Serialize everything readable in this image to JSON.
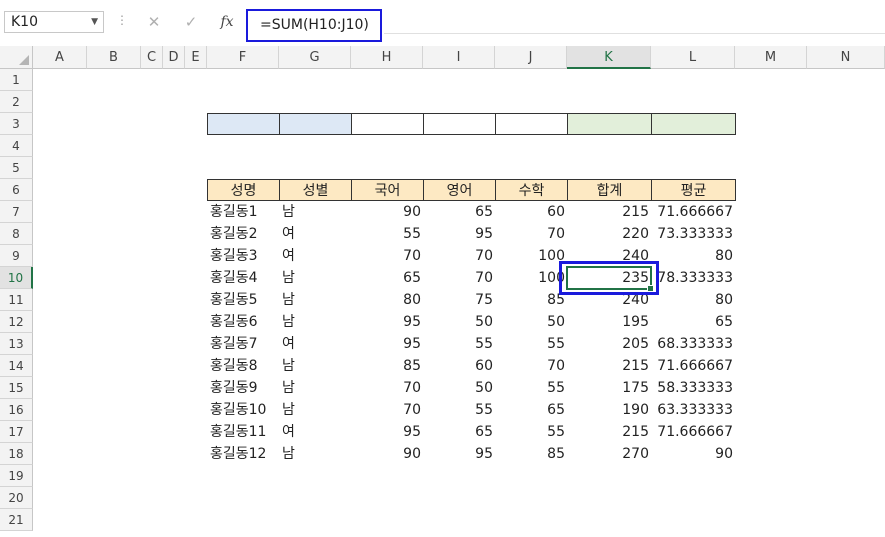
{
  "formula_bar": {
    "name_box": "K10",
    "cancel_icon": "✕",
    "enter_icon": "✓",
    "fx_label": "fx",
    "formula": "=SUM(H10:J10)"
  },
  "columns": [
    "A",
    "B",
    "C",
    "D",
    "E",
    "F",
    "G",
    "H",
    "I",
    "J",
    "K",
    "L",
    "M",
    "N"
  ],
  "rows": [
    "1",
    "2",
    "3",
    "4",
    "5",
    "6",
    "7",
    "8",
    "9",
    "10",
    "11",
    "12",
    "13",
    "14",
    "15",
    "16",
    "17",
    "18",
    "19",
    "20",
    "21"
  ],
  "selected_cell": "K10",
  "table": {
    "headers": [
      "성명",
      "성별",
      "국어",
      "영어",
      "수학",
      "합계",
      "평균"
    ],
    "rows": [
      [
        "홍길동1",
        "남",
        "90",
        "65",
        "60",
        "215",
        "71.666667"
      ],
      [
        "홍길동2",
        "여",
        "55",
        "95",
        "70",
        "220",
        "73.333333"
      ],
      [
        "홍길동3",
        "여",
        "70",
        "70",
        "100",
        "240",
        "80"
      ],
      [
        "홍길동4",
        "남",
        "65",
        "70",
        "100",
        "235",
        "78.333333"
      ],
      [
        "홍길동5",
        "남",
        "80",
        "75",
        "85",
        "240",
        "80"
      ],
      [
        "홍길동6",
        "남",
        "95",
        "50",
        "50",
        "195",
        "65"
      ],
      [
        "홍길동7",
        "여",
        "95",
        "55",
        "55",
        "205",
        "68.333333"
      ],
      [
        "홍길동8",
        "남",
        "85",
        "60",
        "70",
        "215",
        "71.666667"
      ],
      [
        "홍길동9",
        "남",
        "70",
        "50",
        "55",
        "175",
        "58.333333"
      ],
      [
        "홍길동10",
        "남",
        "70",
        "55",
        "65",
        "190",
        "63.333333"
      ],
      [
        "홍길동11",
        "여",
        "95",
        "65",
        "55",
        "215",
        "71.666667"
      ],
      [
        "홍길동12",
        "남",
        "90",
        "95",
        "85",
        "270",
        "90"
      ]
    ]
  },
  "row3_box_colors": [
    "#dde8f5",
    "#dde8f5",
    "#ffffff",
    "#ffffff",
    "#ffffff",
    "#e2efda",
    "#e2efda"
  ],
  "colors": {
    "accent": "#217346",
    "highlight": "#1a1adc",
    "header_fill": "#fde9c3"
  }
}
